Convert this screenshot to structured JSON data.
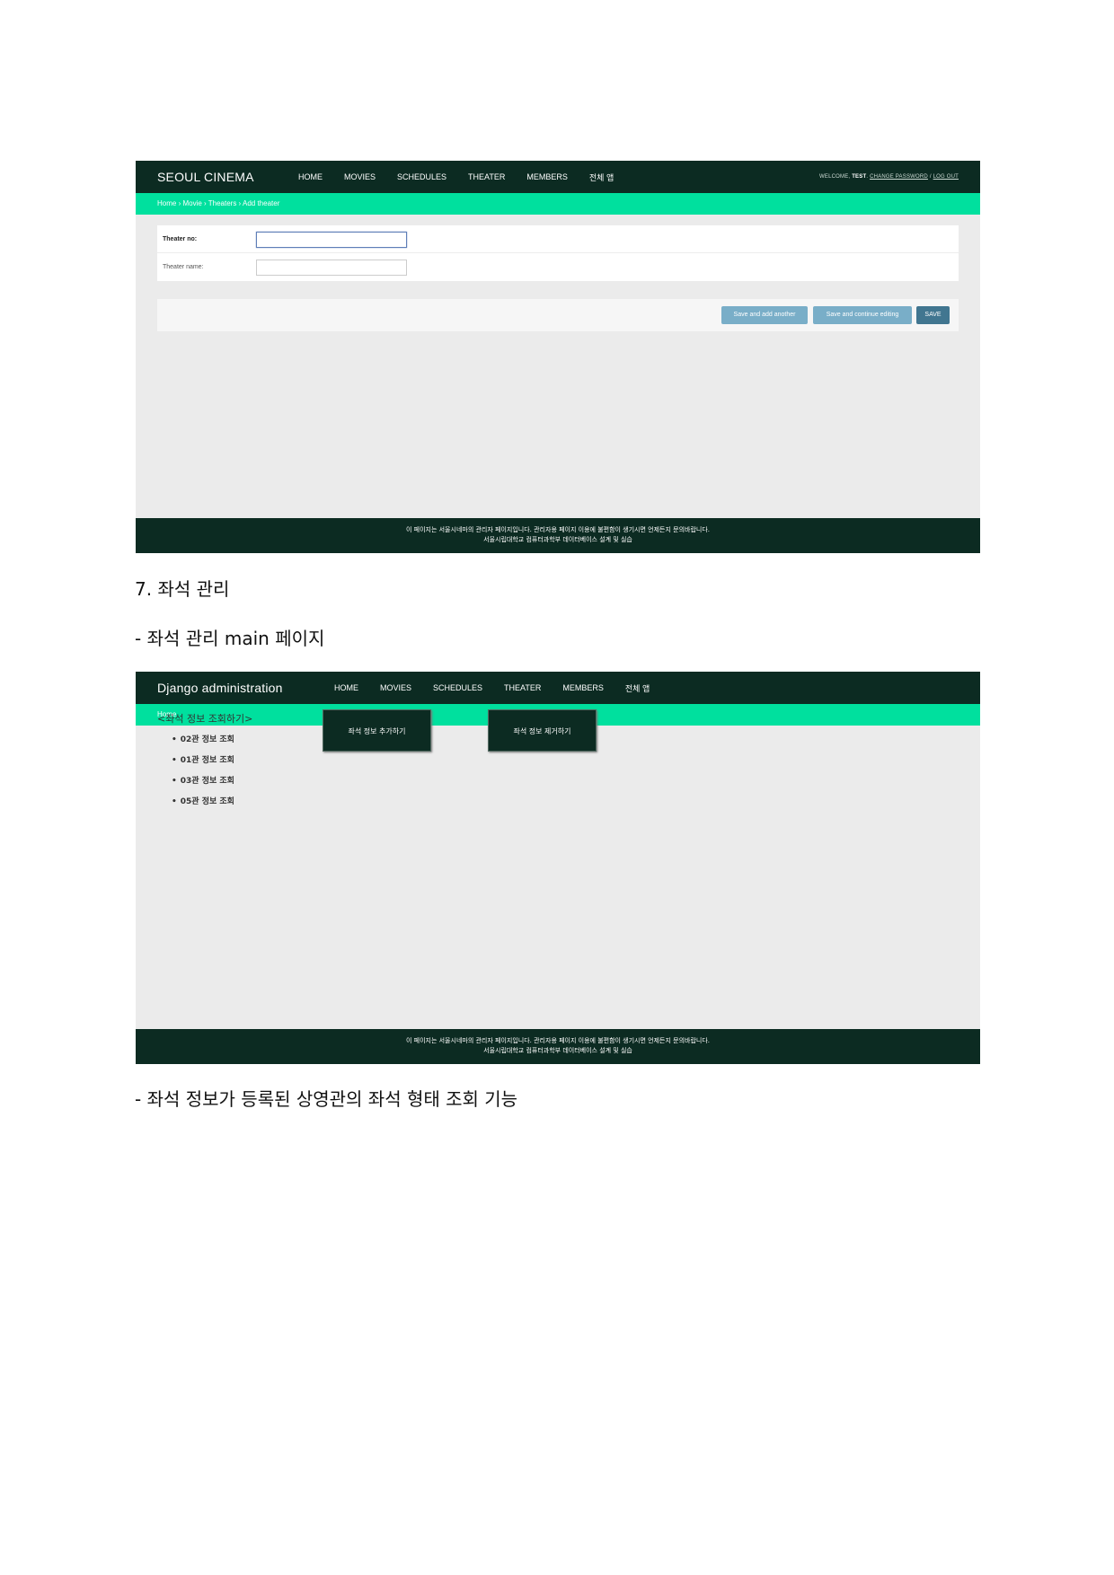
{
  "screenshot1": {
    "brand": "SEOUL CINEMA",
    "nav": [
      "HOME",
      "MOVIES",
      "SCHEDULES",
      "THEATER",
      "MEMBERS",
      "전체 앱"
    ],
    "user_tools": {
      "welcome": "WELCOME,",
      "user": "TEST",
      "change_password": "CHANGE PASSWORD",
      "separator": "/",
      "logout": "LOG OUT"
    },
    "breadcrumb": "Home › Movie › Theaters › Add theater",
    "form": {
      "theater_no_label": "Theater no:",
      "theater_no_value": "",
      "theater_name_label": "Theater name:",
      "theater_name_value": ""
    },
    "buttons": {
      "save_add_another": "Save and add another",
      "save_continue": "Save and continue editing",
      "save": "SAVE"
    },
    "footer": {
      "line1": "이 페이지는 서울시네마의 관리자 페이지입니다. 관리자용 페이지 이용에 불편함이 생기시면 언제든지 문의바랍니다.",
      "line2": "서울시립대학교 컴퓨터과학부 데이터베이스 설계 및 실습"
    }
  },
  "doc": {
    "heading": "7. 좌석 관리",
    "sub_main": "- 좌석 관리 main 페이지",
    "sub_view": "- 좌석 정보가 등록된 상영관의 좌석 형태 조회 기능"
  },
  "screenshot2": {
    "brand": "Django administration",
    "nav": [
      "HOME",
      "MOVIES",
      "SCHEDULES",
      "THEATER",
      "MEMBERS",
      "전체 앱"
    ],
    "breadcrumb": "Home",
    "seat_title": "<좌석 정보 조회하기>",
    "seat_items": [
      "02관 정보 조회",
      "01관 정보 조회",
      "03관 정보 조회",
      "05관 정보 조회"
    ],
    "add_button": "좌석 정보 추가하기",
    "remove_button": "좌석 정보 제거하기",
    "footer": {
      "line1": "이 페이지는 서울시네마의 관리자 페이지입니다. 관리자용 페이지 이용에 불편함이 생기시면 언제든지 문의바랍니다.",
      "line2": "서울시립대학교 컴퓨터과학부 데이터베이스 설계 및 실습"
    }
  },
  "colors": {
    "header_bg": "#0c2b22",
    "breadcrumb_bg": "#00e09e",
    "content_bg": "#ebebeb",
    "button_light": "#79aec8",
    "button_dark": "#417690"
  }
}
